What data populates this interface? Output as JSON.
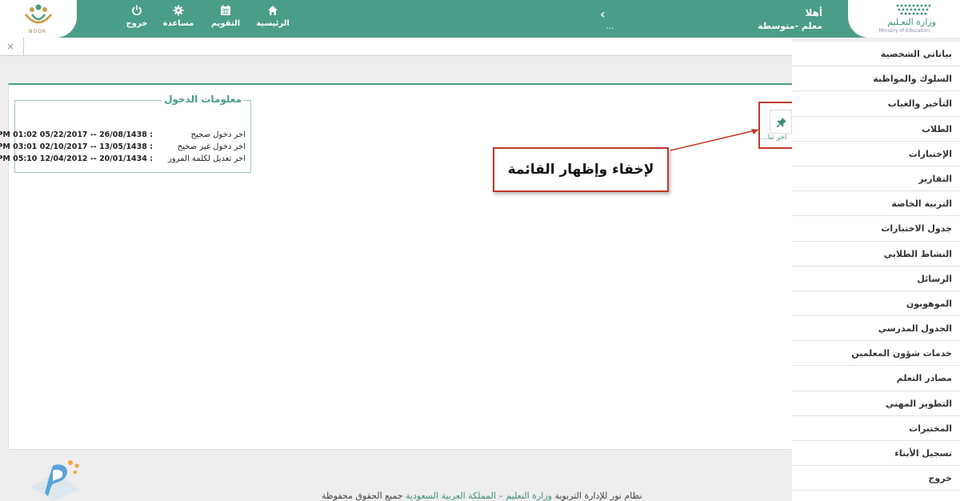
{
  "header": {
    "nour_logo_text": "NOOR",
    "moe_logo_ar": "وزارة التعـليم",
    "moe_logo_en": "Ministry of Education",
    "greeting": "أهلا",
    "role": "معلم -متوسطة",
    "back_icon": "chevron-left-icon",
    "dots": "...",
    "nav": [
      {
        "label": "الرئيسية",
        "icon": "home-icon"
      },
      {
        "label": "التقويم",
        "icon": "calendar-icon"
      },
      {
        "label": "مساعدة",
        "icon": "gear-icon"
      },
      {
        "label": "خروج",
        "icon": "power-icon"
      }
    ],
    "color": "#4a9d86"
  },
  "tabbar": {
    "close_glyph": "×"
  },
  "sidebar": {
    "items": [
      "بياناتي الشخصية",
      "السلوك والمواظبة",
      "التأخير والغياب",
      "الطلاب",
      "الإختبارات",
      "التقارير",
      "التربية الخاصة",
      "جدول الاختبارات",
      "النشاط الطلابي",
      "الرسائل",
      "الموهوبون",
      "الجدول المدرسي",
      "خدمات شؤون المعلمين",
      "مصادر التعلم",
      "التطوير المهني",
      "المختبرات",
      "تسجيل الأبناء",
      "خروج"
    ]
  },
  "login_info": {
    "title": "معلومات الدخول",
    "rows": [
      {
        "label": "اخر دخول صحيح",
        "value": ": 26/08/1438 -- 05/22/2017 01:02 PM"
      },
      {
        "label": "اخر دخول غير صحيح",
        "value": ": 13/05/1438 -- 02/10/2017 03:01 PM"
      },
      {
        "label": "اخر تعديل لكلمة المرور",
        "value": ": 20/01/1434 -- 12/04/2012 05:10 PM"
      }
    ]
  },
  "pin": {
    "icon": "pin-icon",
    "sublabel": "اخر تنا..."
  },
  "callout": {
    "text": "لإخفاء وإظهار القائمة",
    "color": "#c0392b"
  },
  "footer": {
    "prefix": "نظام نور للإدارة التربوية",
    "highlight": "وزارة التعليم – المملكة العربية السعودية",
    "suffix": "جميع الحقوق محفوظة"
  }
}
